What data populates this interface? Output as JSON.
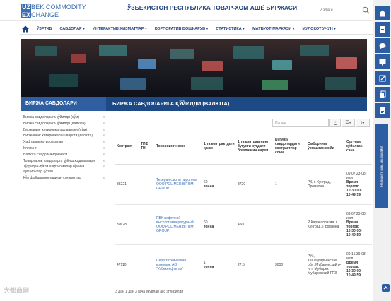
{
  "header": {
    "logo_line1_box": "UZ",
    "logo_line1_text": "BEK COMMODITY",
    "logo_line2_box": "EX",
    "logo_line2_text": "CHANGE",
    "title": "ЎЗБЕКИСТОН РЕСПУБЛИКА ТОВАР-ХОМ АШЁ БИРЖАСИ",
    "search_placeholder": "Излаш"
  },
  "nav": {
    "items": [
      "ЎЗРТХБ",
      "САВДОЛАР",
      "ИНТЕРАКТИВ ХИЗМАТЛАР",
      "КОРПОРАТИВ БОШҚАРУВ",
      "СТАТИСТИКА",
      "МАТБУОТ-МАРКАЗИ",
      "МУЛОҚОТ УЧУН"
    ]
  },
  "sidebar": {
    "title": "БИРЖА САВДОЛАРИ",
    "items": [
      "Биржа савдоларига қўйилди (сўм)",
      "Биржа савдоларига қўйилди (валюта)",
      "Биржанинг котировкалаш варақи (сўм)",
      "Биржанинг котировкалаш вароги (валюта)",
      "Хафталик котировкалар",
      "Клиринг",
      "Валюта савдо майдончаси",
      "Товарларни савдоларга қўйиш жадваллари",
      "Тўғридан-тўғри шартномалар бўйича аукционлар (ўтиш",
      "Кўп фойдаланиладиган сукчиятлар"
    ]
  },
  "main": {
    "title": "БИРЖА САВДОЛАРИГА ҚЎЙИЛДИ (ВАЛЮТА)",
    "search_placeholder": "Излаш",
    "refresh_icon": "refresh-icon",
    "columns_icon": "columns-icon",
    "export_icon": "export-icon"
  },
  "table": {
    "headers": [
      "Контракт",
      "ТИФ ТН",
      "Товарнинг номи",
      "1 та контрактдаги ҳажм",
      "1 та контрактнинг бугунги хуқдаги бошланғич нархи",
      "Бугунги савдолардаги контрактлар сони",
      "Омборнинг ўрнашган жойи",
      "Сотувга қўйилган сана"
    ],
    "rows": [
      {
        "contract": "38221",
        "tif": "",
        "name": "Техерая смола пиролиза ООО POLIMER BITUM GROUP",
        "volume": "60",
        "unit": "тонна",
        "price": "3720",
        "count": "1",
        "location": "РК, г. Кунград, Промзона",
        "date": "09.07.23-08-июл",
        "time_label": "Время торгов:",
        "time": "10:30:00-10:49:59"
      },
      {
        "contract": "39628",
        "tif": "",
        "name": "ПВК нефтяной высокотемпературный ООО POLIMER BITUM GROUP",
        "volume": "60",
        "unit": "тонна",
        "price": "4500",
        "count": "1",
        "location": "Р Каракалпакия, г. Кунград, Промзона",
        "date": "09.07.23-08-июл",
        "time_label": "Время торгов:",
        "time": "10:30:00-10:49:59"
      },
      {
        "contract": "47110",
        "tif": "",
        "name": "Сера техническая комовая, АО \"Узбекнефтегаз\"",
        "volume": "1",
        "unit": "тонна",
        "price": "27.5",
        "count": "3000",
        "location": "РУз, Кашкадарьинская обл. Мубарекский р-н, г. Мубарек, Мубарекский ГПЗ",
        "date": "09.15.39-08-июл",
        "time_label": "Время торгов:",
        "time": "10:30:00-10:49:59"
      }
    ]
  },
  "footer_note": "3 дан 1 дан 3 гача ёзувлар акс эттирилди",
  "watermark": "大都商网",
  "rail": {
    "feedback_text": "Напишите нам, мы онлайн!",
    "accent_color": "#2d5ea3"
  },
  "colors": {
    "brand_blue": "#1d4a85",
    "side_blue": "#2f5fa1",
    "link_blue": "#3a6fb5"
  }
}
